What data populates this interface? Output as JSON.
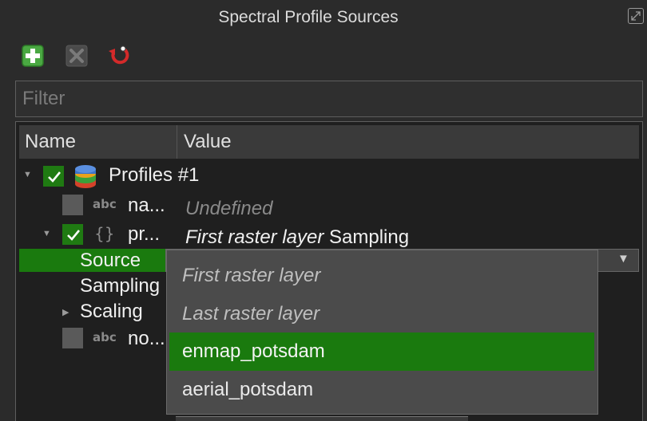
{
  "panel": {
    "title": "Spectral Profile Sources"
  },
  "filter": {
    "placeholder": "Filter",
    "value": ""
  },
  "tree": {
    "columns": [
      "Name",
      "Value"
    ],
    "rows": [
      {
        "label": "Profiles #1",
        "checked": true,
        "value": ""
      },
      {
        "label": "na...",
        "type": "abc",
        "checked": false,
        "value": "Undefined"
      },
      {
        "label": "pr...",
        "type": "{}",
        "checked": true,
        "value_italic": "First raster layer",
        "value_rest": " Sampling"
      },
      {
        "label": "Source",
        "selected": true
      },
      {
        "label": "Sampling"
      },
      {
        "label": "Scaling"
      },
      {
        "label": "no...",
        "type": "abc",
        "checked": false
      }
    ]
  },
  "dropdown": {
    "options": [
      "First raster layer",
      "Last raster layer",
      "enmap_potsdam",
      "aerial_potsdam"
    ],
    "selected": "enmap_potsdam"
  },
  "colors": {
    "accent_green": "#1a7a0e",
    "background": "#2b2b2b",
    "tree_background": "#1f1f1f"
  }
}
